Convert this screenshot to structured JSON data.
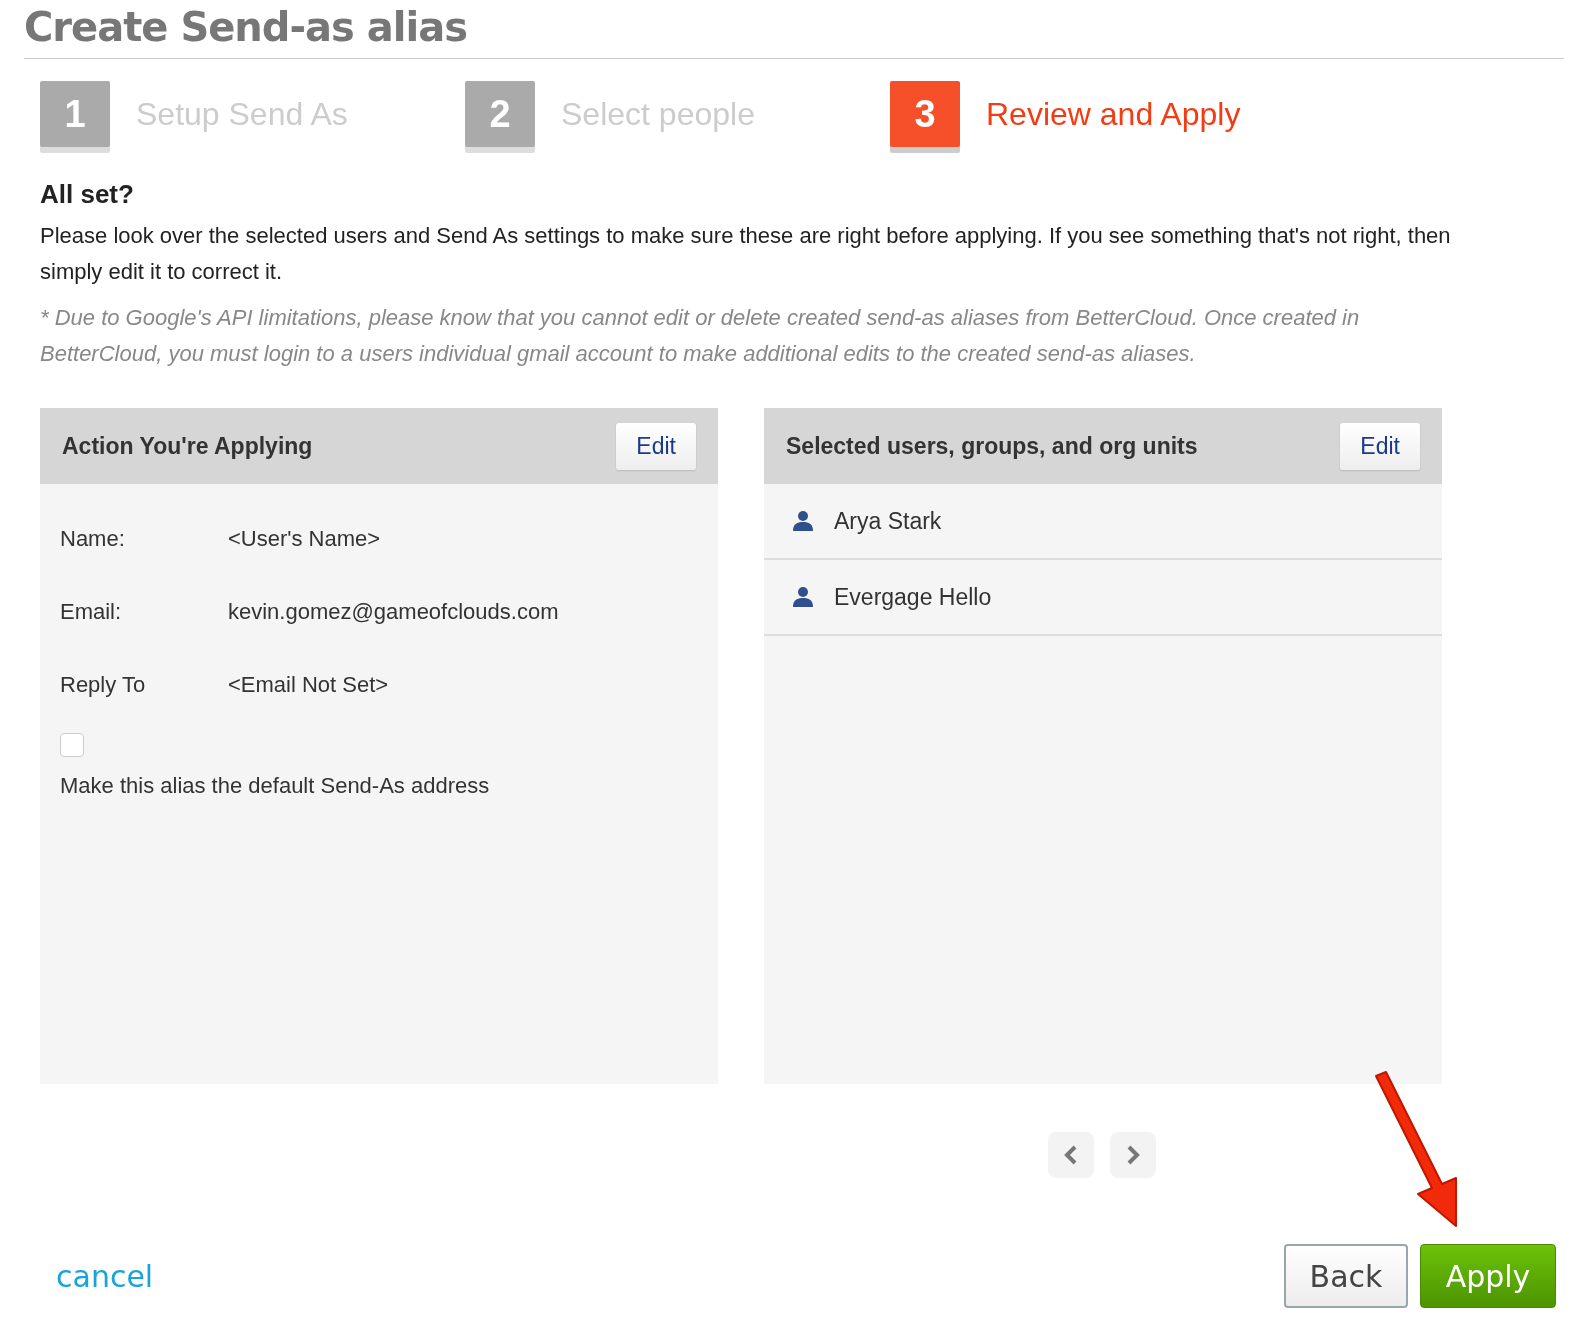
{
  "title": "Create Send-as alias",
  "steps": [
    {
      "number": "1",
      "label": "Setup Send As",
      "selected": false
    },
    {
      "number": "2",
      "label": "Select people",
      "selected": false
    },
    {
      "number": "3",
      "label": "Review and Apply",
      "selected": true
    }
  ],
  "heading": "All set?",
  "intro": "Please look over the selected users and Send As settings to make sure these are right before applying. If you see something that's not right, then simply edit it to correct it.",
  "note": "* Due to Google's API limitations, please know that you cannot edit or delete created send-as aliases from BetterCloud. Once created in BetterCloud, you must login to a users individual gmail account to make additional edits to the created send-as aliases.",
  "action_panel": {
    "title": "Action You're Applying",
    "edit": "Edit",
    "fields": [
      {
        "label": "Name:",
        "value": "<User's Name>"
      },
      {
        "label": "Email:",
        "value": "kevin.gomez@gameofclouds.com"
      },
      {
        "label": "Reply To",
        "value": "<Email Not Set>"
      }
    ],
    "default_checkbox": {
      "label": "Make this alias the default Send-As address",
      "checked": false
    }
  },
  "people_panel": {
    "title": "Selected users, groups, and org units",
    "edit": "Edit",
    "items": [
      {
        "name": "Arya Stark"
      },
      {
        "name": "Evergage Hello"
      }
    ]
  },
  "cancel": "cancel",
  "buttons": {
    "back": "Back",
    "apply": "Apply"
  }
}
